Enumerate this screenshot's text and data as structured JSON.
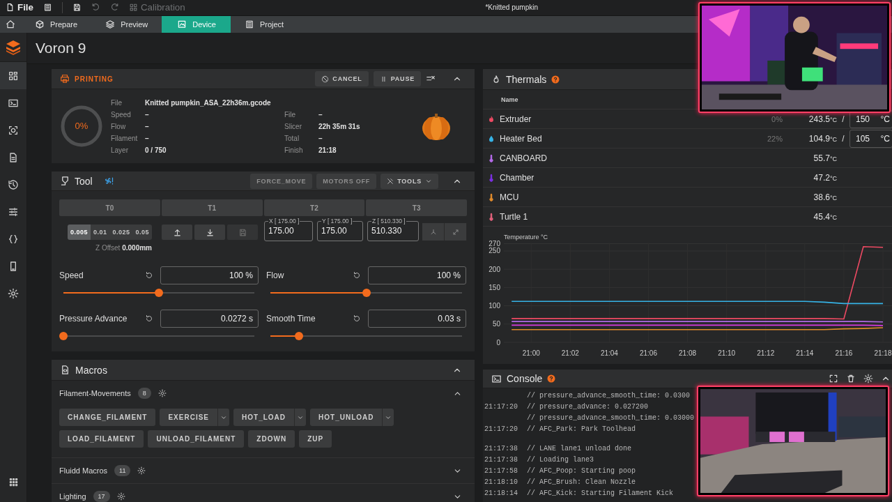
{
  "window": {
    "title": "*Knitted pumpkin"
  },
  "toolbar": {
    "items": [
      {
        "kind": "file",
        "label": "File",
        "disabled": false
      },
      {
        "kind": "list",
        "disabled": false
      },
      {
        "kind": "save",
        "disabled": false
      },
      {
        "kind": "undo",
        "disabled": true
      },
      {
        "kind": "redo",
        "disabled": true
      },
      {
        "kind": "calibration",
        "label": "Calibration",
        "disabled": true
      }
    ]
  },
  "tabs": [
    {
      "kind": "prepare",
      "label": "Prepare",
      "selected": false
    },
    {
      "kind": "preview",
      "label": "Preview",
      "selected": false
    },
    {
      "kind": "device",
      "label": "Device",
      "selected": true
    },
    {
      "kind": "project",
      "label": "Project",
      "selected": false
    }
  ],
  "home_button": {
    "kind": "home"
  },
  "sidebar": {
    "items": [
      {
        "kind": "dashboard",
        "selected": true
      },
      {
        "kind": "console",
        "selected": false
      },
      {
        "kind": "camera",
        "selected": false
      },
      {
        "kind": "files",
        "selected": false
      },
      {
        "kind": "history",
        "selected": false
      },
      {
        "kind": "tune",
        "selected": false
      },
      {
        "kind": "code",
        "selected": false
      },
      {
        "kind": "device",
        "selected": false
      },
      {
        "kind": "settings",
        "selected": false
      }
    ],
    "bottom_item": {
      "kind": "apps"
    }
  },
  "printer": {
    "name": "Voron 9"
  },
  "printing": {
    "status": "PRINTING",
    "buttons": [
      {
        "kind": "cancel",
        "label": "CANCEL"
      },
      {
        "kind": "pause",
        "label": "PAUSE"
      }
    ],
    "progress": {
      "label": "0%",
      "level": 0
    },
    "details_left": [
      {
        "label": "File",
        "value": "Knitted pumpkin_ASA_22h36m.gcode"
      },
      {
        "label": "Speed",
        "value": "–"
      },
      {
        "label": "Flow",
        "value": "–"
      },
      {
        "label": "Filament",
        "value": "–"
      },
      {
        "label": "Layer",
        "value": "0 / 750"
      }
    ],
    "details_right": [
      {
        "label": "File",
        "value": "–"
      },
      {
        "label": "Slicer",
        "value": "22h 35m 31s"
      },
      {
        "label": "Total",
        "value": "–"
      },
      {
        "label": "Finish",
        "value": "21:18"
      }
    ]
  },
  "tool": {
    "title": "Tool",
    "actions": [
      {
        "kind": "plain",
        "label": "FORCE_MOVE"
      },
      {
        "kind": "plain",
        "label": "MOTORS OFF"
      },
      {
        "kind": "menu",
        "label": "TOOLS"
      }
    ],
    "tools": [
      {
        "label": "T0",
        "selected": false
      },
      {
        "label": "T1",
        "selected": false
      },
      {
        "label": "T2",
        "selected": false
      },
      {
        "label": "T3",
        "selected": false
      }
    ],
    "steps": [
      {
        "label": "0.005",
        "selected": true
      },
      {
        "label": "0.01",
        "selected": false
      },
      {
        "label": "0.025",
        "selected": false
      },
      {
        "label": "0.05",
        "selected": false
      }
    ],
    "z_offset": {
      "label": "Z Offset",
      "value": "0.000mm"
    },
    "move_buttons": [
      {
        "kind": "raise",
        "disabled": false
      },
      {
        "kind": "lower",
        "disabled": false
      },
      {
        "kind": "save",
        "disabled": true
      }
    ],
    "axes": [
      {
        "label": "X [ 175.00 ]",
        "value": "175.00"
      },
      {
        "label": "Y [ 175.00 ]",
        "value": "175.00"
      },
      {
        "label": "Z [ 510.330 ]",
        "value": "510.330"
      }
    ],
    "position_buttons": [
      {
        "kind": "home"
      },
      {
        "kind": "expand"
      }
    ],
    "adjusters": [
      {
        "label": "Speed",
        "value": "100 %",
        "level": 0.5
      },
      {
        "label": "Flow",
        "value": "100 %",
        "level": 0.5
      },
      {
        "label": "Pressure Advance",
        "value": "0.0272 s",
        "level": 0
      },
      {
        "label": "Smooth Time",
        "value": "0.03 s",
        "level": 0.15
      }
    ]
  },
  "macros": {
    "title": "Macros",
    "groups": [
      {
        "name": "Filament-Movements",
        "count": "8",
        "expanded": true,
        "macros": [
          {
            "label": "CHANGE_FILAMENT",
            "has_menu": false
          },
          {
            "label": "EXERCISE",
            "has_menu": true
          },
          {
            "label": "HOT_LOAD",
            "has_menu": true
          },
          {
            "label": "HOT_UNLOAD",
            "has_menu": true
          },
          {
            "label": "LOAD_FILAMENT",
            "has_menu": false
          },
          {
            "label": "UNLOAD_FILAMENT",
            "has_menu": false
          },
          {
            "label": "ZDOWN",
            "has_menu": false
          },
          {
            "label": "ZUP",
            "has_menu": false
          }
        ]
      },
      {
        "name": "Fluidd Macros",
        "count": "11",
        "expanded": false
      },
      {
        "name": "Lighting",
        "count": "17",
        "expanded": false
      }
    ]
  },
  "thermals": {
    "title": "Thermals",
    "columns": [
      {
        "label": "Name"
      }
    ],
    "sensors": [
      {
        "kind": "extruder",
        "name": "Extruder",
        "color": "#ef4a63",
        "power": "0%",
        "temp": "243.5",
        "unit": "°C",
        "separator": "/",
        "target": "150",
        "target_unit": "°C"
      },
      {
        "kind": "bed",
        "name": "Heater Bed",
        "color": "#36b3e6",
        "power": "22%",
        "temp": "104.9",
        "unit": "°C",
        "separator": "/",
        "target": "105",
        "target_unit": "°C"
      },
      {
        "kind": "sensor",
        "name": "CANBOARD",
        "color": "#b36ae8",
        "temp": "55.7",
        "unit": "°C"
      },
      {
        "kind": "sensor",
        "name": "Chamber",
        "color": "#7a2fe0",
        "temp": "47.2",
        "unit": "°C"
      },
      {
        "kind": "sensor",
        "name": "MCU",
        "color": "#e08a2b",
        "temp": "38.6",
        "unit": "°C"
      },
      {
        "kind": "sensor",
        "name": "Turtle 1",
        "color": "#e0607a",
        "temp": "45.4",
        "unit": "°C"
      }
    ],
    "chart_data": {
      "type": "line",
      "title": "Temperature °C",
      "categories": [
        null,
        "21:00",
        null,
        "21:02",
        null,
        "21:04",
        null,
        "21:06",
        null,
        "21:08",
        null,
        "21:10",
        null,
        "21:12",
        null,
        "21:14",
        null,
        "21:16",
        null,
        "21:18"
      ],
      "ylim": [
        0,
        270
      ],
      "grid": true,
      "yticks": [
        0,
        50,
        100,
        150,
        200,
        250,
        270
      ],
      "series": [
        {
          "color": "#ef4a63",
          "values": [
            65,
            65,
            65,
            65,
            65,
            65,
            65,
            65,
            65,
            65,
            65,
            65,
            65,
            65,
            65,
            65,
            65,
            64,
            262,
            260
          ]
        },
        {
          "color": "#36b3e6",
          "values": [
            112,
            112,
            112,
            112,
            112,
            112,
            112,
            112,
            112,
            112,
            112,
            112,
            112,
            112,
            112,
            112,
            110,
            106,
            106,
            106
          ]
        },
        {
          "color": "#b36ae8",
          "values": [
            57,
            57,
            57,
            57,
            57,
            57,
            57,
            57,
            57,
            57,
            57,
            57,
            57,
            57,
            57,
            57,
            57,
            57,
            57,
            56
          ]
        },
        {
          "color": "#d63adf",
          "values": [
            47,
            47,
            47,
            47,
            47,
            47,
            47,
            47,
            47,
            47,
            47,
            47,
            47,
            47,
            47,
            47,
            47,
            47,
            47,
            46
          ]
        },
        {
          "color": "#e08a2b",
          "values": [
            35,
            35,
            35,
            35,
            35,
            35,
            35,
            35,
            35,
            35,
            35,
            35,
            35,
            35,
            35,
            35,
            35,
            37,
            38,
            40
          ]
        }
      ]
    }
  },
  "console": {
    "title": "Console",
    "groups": [
      {
        "lines": [
          {
            "text": "// pressure_advance_smooth_time: 0.0300"
          },
          {
            "time": "21:17:20",
            "text": "// pressure_advance: 0.027200"
          },
          {
            "text": "// pressure_advance_smooth_time: 0.03000"
          },
          {
            "time": "21:17:20",
            "text": "// AFC_Park: Park Toolhead"
          }
        ]
      },
      {
        "lines": [
          {
            "time": "21:17:38",
            "text": "// LANE lane1 unload done"
          },
          {
            "time": "21:17:38",
            "text": "// Loading lane3"
          },
          {
            "time": "21:17:58",
            "text": "// AFC_Poop: Starting poop"
          },
          {
            "time": "21:18:10",
            "text": "// AFC_Brush: Clean Nozzle"
          },
          {
            "time": "21:18:14",
            "text": "// AFC_Kick: Starting Filament Kick"
          }
        ]
      }
    ]
  }
}
